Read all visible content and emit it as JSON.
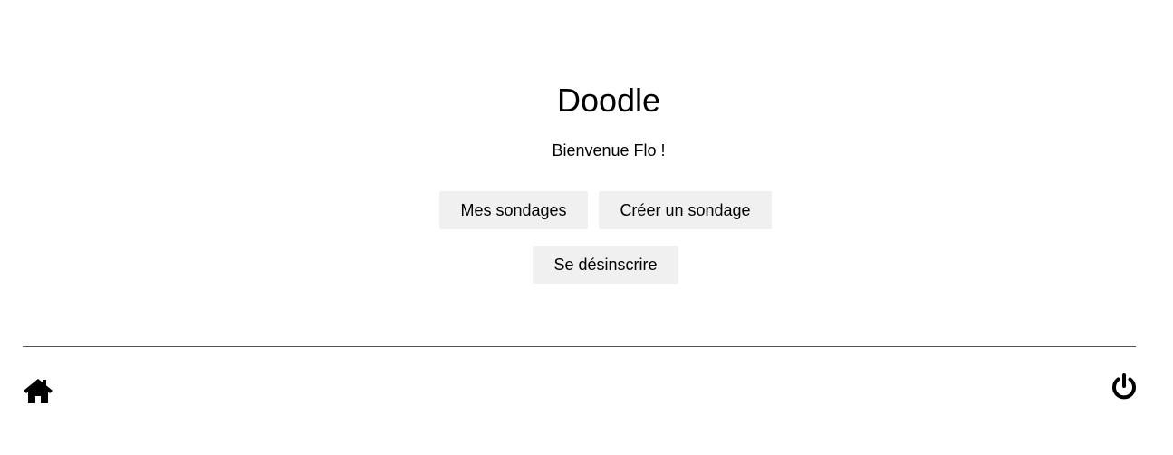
{
  "app": {
    "title": "Doodle",
    "welcome": "Bienvenue Flo !"
  },
  "actions": {
    "mes_sondages": "Mes sondages",
    "creer_sondage": "Créer un sondage",
    "se_desinscrire": "Se désinscrire"
  },
  "footer": {
    "home_icon": "home-icon",
    "logout_icon": "power-icon"
  },
  "colors": {
    "button_bg": "#f0f0f0",
    "divider": "#555555",
    "text": "#000000"
  }
}
